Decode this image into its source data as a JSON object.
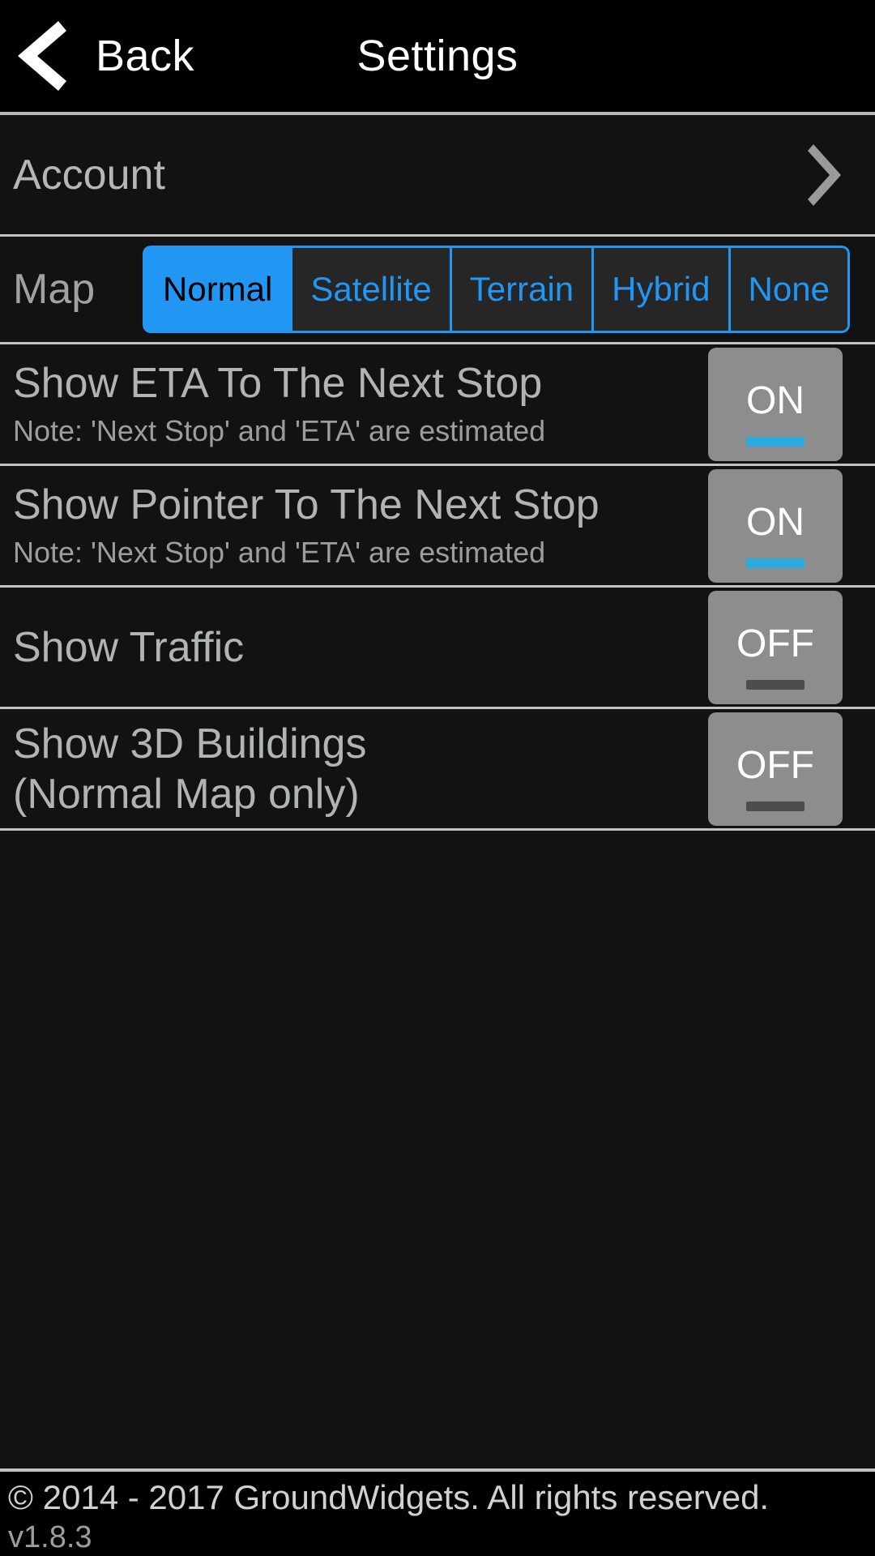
{
  "header": {
    "back_label": "Back",
    "title": "Settings",
    "back_icon": "chevron-left-icon"
  },
  "rows": {
    "account": {
      "label": "Account",
      "chevron_icon": "chevron-right-icon"
    },
    "map": {
      "label": "Map",
      "options": [
        {
          "label": "Normal",
          "selected": true
        },
        {
          "label": "Satellite",
          "selected": false
        },
        {
          "label": "Terrain",
          "selected": false
        },
        {
          "label": "Hybrid",
          "selected": false
        },
        {
          "label": "None",
          "selected": false
        }
      ]
    },
    "eta": {
      "title": "Show ETA To The Next Stop",
      "note": "Note: 'Next Stop' and 'ETA' are estimated",
      "toggle_state": "ON"
    },
    "pointer": {
      "title": "Show Pointer To The Next Stop",
      "note": "Note: 'Next Stop' and 'ETA' are estimated",
      "toggle_state": "ON"
    },
    "traffic": {
      "title": "Show Traffic",
      "toggle_state": "OFF"
    },
    "buildings": {
      "title": "Show 3D Buildings",
      "title_line2": "(Normal Map only)",
      "toggle_state": "OFF"
    }
  },
  "footer": {
    "copyright": "© 2014 - 2017 GroundWidgets. All rights reserved.",
    "version": "v1.8.3"
  },
  "colors": {
    "accent_blue": "#2196f3",
    "toggle_on_bar": "#29abe2",
    "toggle_off_bar": "#4d4d4d",
    "toggle_bg": "#8d8d8d",
    "divider": "#c2c2c2",
    "text_primary": "#b0b4b3",
    "background": "#121212"
  }
}
